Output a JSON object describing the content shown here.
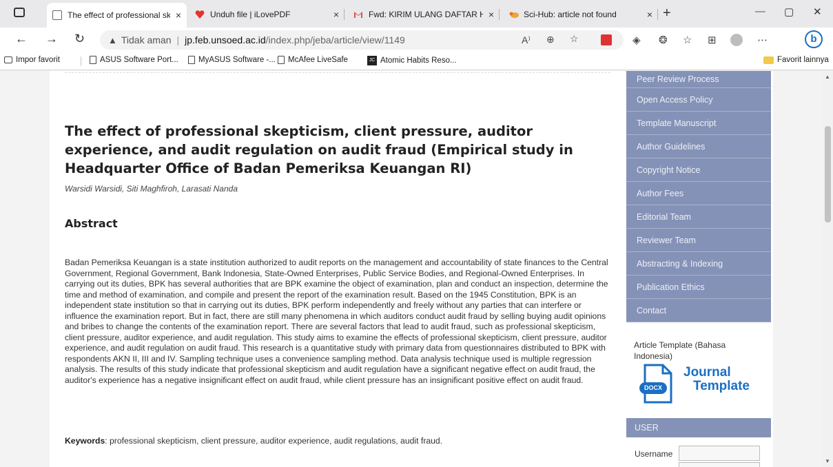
{
  "tabs": [
    {
      "title": "The effect of professional skeptic",
      "close": "×",
      "active": true
    },
    {
      "title": "Unduh file | iLovePDF",
      "close": "×",
      "active": false
    },
    {
      "title": "Fwd: KIRIM ULANG DAFTAR HAS",
      "close": "×",
      "active": false
    },
    {
      "title": "Sci-Hub: article not found",
      "close": "×",
      "active": false
    }
  ],
  "new_tab": "+",
  "window_controls": {
    "minimize": "—",
    "maximize": "▢",
    "close": "✕"
  },
  "address": {
    "security_icon": "▲",
    "security_text": "Tidak aman",
    "separator": "|",
    "domain": "jp.feb.unsoed.ac.id",
    "path": "/index.php/jeba/article/view/1149"
  },
  "bookmarks": [
    {
      "label": "Impor favorit",
      "icon": "import-icon"
    },
    {
      "label": "ASUS Software Port...",
      "icon": "page-icon"
    },
    {
      "label": "MyASUS Software -...",
      "icon": "page-icon"
    },
    {
      "label": "McAfee LiveSafe",
      "icon": "page-icon"
    },
    {
      "label": "Atomic Habits Reso...",
      "icon": "jc-icon"
    }
  ],
  "other_favorites": "Favorit lainnya",
  "article": {
    "title": "The effect of professional skepticism, client pressure, auditor experience, and audit regulation on audit fraud (Empirical study in Headquarter Office of Badan Pemeriksa Keuangan RI)",
    "authors": "Warsidi Warsidi, Siti Maghfiroh, Larasati Nanda",
    "abstract_heading": "Abstract",
    "abstract": "Badan Pemeriksa Keuangan is a state institution authorized to audit reports on the management and accountability of state finances to the Central Government, Regional Government, Bank Indonesia, State-Owned Enterprises, Public Service Bodies, and Regional-Owned Enterprises. In carrying out its duties, BPK has several authorities that are BPK examine the object of examination, plan and conduct an inspection, determine the time and method of examination, and compile and present the report of the examination result. Based on the 1945 Constitution, BPK is an independent state institution so that in carrying out its duties, BPK perform independently and freely without any parties that can interfere or influence the examination report. But in fact, there are still many phenomena in which auditors conduct audit fraud by selling buying audit opinions and bribes to change the contents of the examination report. There are several factors that lead to audit fraud, such as professional skepticism, client pressure, auditor experience, and audit regulation. This study aims to examine the effects of professional skepticism, client pressure, auditor experience, and audit regulation on audit fraud. This research is a quantitative study with primary data from questionnaires distributed to BPK with respondents AKN II, III and IV. Sampling technique uses a convenience sampling method. Data analysis technique used is multiple regression analysis. The results of this study indicate that professional skepticism and audit regulation have a significant negative effect on audit fraud, the auditor's experience has a negative insignificant effect on audit fraud, while client pressure has an insignificant positive effect on audit fraud.",
    "keywords_label": "Keywords",
    "keywords": ": professional skepticism, client pressure, auditor experience, audit regulations, audit fraud."
  },
  "sidebar": {
    "menu": [
      "Peer Review Process",
      "Open Access Policy",
      "Template Manuscript",
      "Author Guidelines",
      "Copyright Notice",
      "Author Fees",
      "Editorial Team",
      "Reviewer Team",
      "Abstracting & Indexing",
      "Publication Ethics",
      "Contact"
    ],
    "template_label": "Article Template (Bahasa Indonesia)",
    "docx_badge": "DOCX",
    "docx_line1": "Journal",
    "docx_line2": "Template",
    "user_heading": "USER",
    "username_label": "Username"
  },
  "colors": {
    "sidebar_menu": "#8592b7",
    "accent_blue": "#1a6fc4"
  }
}
